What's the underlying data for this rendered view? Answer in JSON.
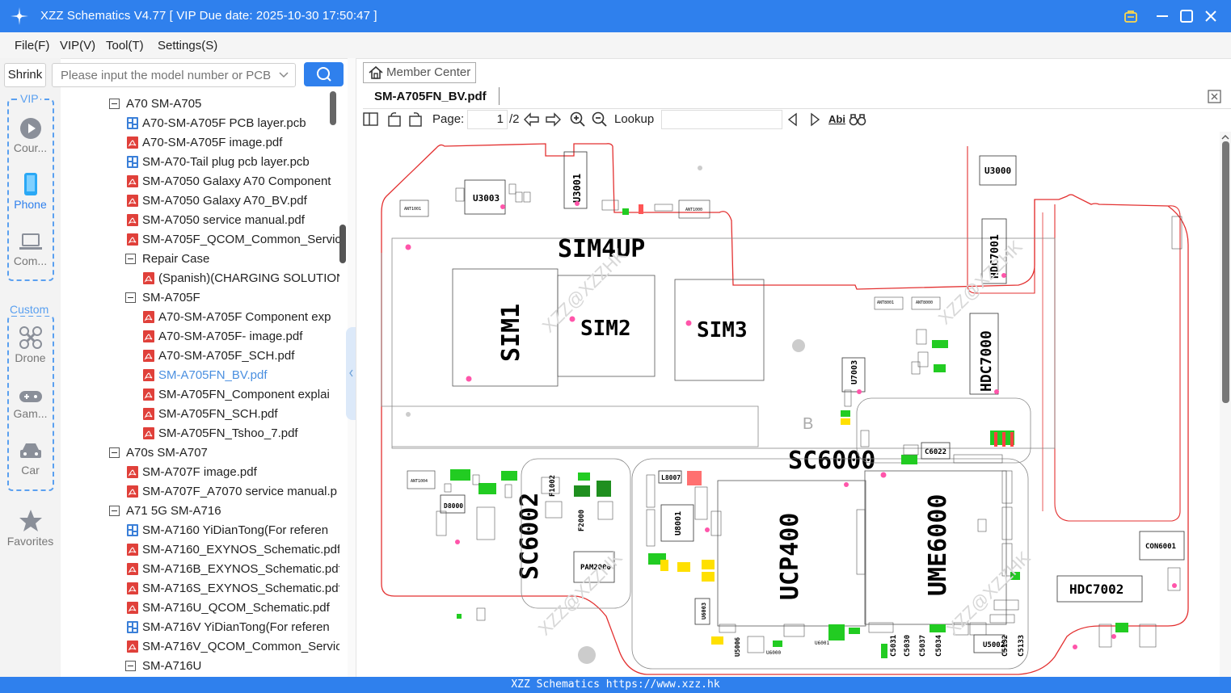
{
  "app": {
    "title": "XZZ Schematics V4.77 [ VIP Due date: 2025-10-30 17:50:47 ]",
    "status_bar": "XZZ Schematics https://www.xzz.hk"
  },
  "menu": [
    "File(F)",
    "VIP(V)",
    "Tool(T)",
    "Settings(S)"
  ],
  "search": {
    "shrink_label": "Shrink",
    "placeholder": "Please input the model number or PCB"
  },
  "rail": {
    "vip_label": "VIP",
    "custom_label": "Custom",
    "items": [
      "Cour...",
      "Phone",
      "Com...",
      "Drone",
      "Gam...",
      "Car",
      "Favorites"
    ]
  },
  "tree": [
    {
      "label": "A70 SM-A705",
      "kind": "folder"
    },
    {
      "label": "A70-SM-A705F PCB layer.pcb",
      "kind": "pcb"
    },
    {
      "label": "A70-SM-A705F image.pdf",
      "kind": "pdf"
    },
    {
      "label": "SM-A70-Tail plug pcb layer.pcb",
      "kind": "pcb"
    },
    {
      "label": "SM-A7050 Galaxy A70 Component",
      "kind": "pdf"
    },
    {
      "label": "SM-A7050 Galaxy A70_BV.pdf",
      "kind": "pdf"
    },
    {
      "label": "SM-A7050 service manual.pdf",
      "kind": "pdf"
    },
    {
      "label": "SM-A705F_QCOM_Common_Servic",
      "kind": "pdf"
    },
    {
      "label": "Repair Case",
      "kind": "folder"
    },
    {
      "label": "(Spanish)(CHARGING SOLUTION",
      "kind": "pdf"
    },
    {
      "label": "SM-A705F",
      "kind": "folder"
    },
    {
      "label": "A70-SM-A705F Component exp",
      "kind": "pdf"
    },
    {
      "label": "A70-SM-A705F- image.pdf",
      "kind": "pdf"
    },
    {
      "label": "A70-SM-A705F_SCH.pdf",
      "kind": "pdf"
    },
    {
      "label": "SM-A705FN_BV.pdf",
      "kind": "pdf",
      "selected": true
    },
    {
      "label": "SM-A705FN_Component explai",
      "kind": "pdf"
    },
    {
      "label": "SM-A705FN_SCH.pdf",
      "kind": "pdf"
    },
    {
      "label": "SM-A705FN_Tshoo_7.pdf",
      "kind": "pdf"
    },
    {
      "label": "A70s SM-A707",
      "kind": "folder"
    },
    {
      "label": "SM-A707F image.pdf",
      "kind": "pdf"
    },
    {
      "label": "SM-A707F_A7070 service manual.p",
      "kind": "pdf"
    },
    {
      "label": "A71 5G SM-A716",
      "kind": "folder"
    },
    {
      "label": "SM-A7160 YiDianTong(For referen",
      "kind": "pcb"
    },
    {
      "label": "SM-A7160_EXYNOS_Schematic.pdf",
      "kind": "pdf"
    },
    {
      "label": "SM-A716B_EXYNOS_Schematic.pdf",
      "kind": "pdf"
    },
    {
      "label": "SM-A716S_EXYNOS_Schematic.pdf",
      "kind": "pdf"
    },
    {
      "label": "SM-A716U_QCOM_Schematic.pdf",
      "kind": "pdf"
    },
    {
      "label": "SM-A716V YiDianTong(For referen",
      "kind": "pcb"
    },
    {
      "label": "SM-A716V_QCOM_Common_Servic",
      "kind": "pdf"
    },
    {
      "label": "SM-A716U",
      "kind": "folder"
    }
  ],
  "viewer": {
    "member_center": "Member Center",
    "tab_name": "SM-A705FN_BV.pdf",
    "page_label": "Page:",
    "page_value": "1",
    "page_total": "/2",
    "lookup_label": "Lookup",
    "abi_label": "Abi"
  },
  "board": {
    "big_labels": [
      "SIM4UP",
      "SIM1",
      "SIM2",
      "SIM3",
      "SC6000",
      "SC6002",
      "UCP400",
      "UME6000"
    ],
    "parts": [
      "U3003",
      "U3001",
      "U3000",
      "HDC7001",
      "HDC7000",
      "HDC7002",
      "U7003",
      "C6022",
      "CON6001",
      "D8000",
      "L8007",
      "U8001",
      "PAM2000",
      "F1002",
      "F2000",
      "U5002",
      "C5031",
      "C5030",
      "C5037",
      "C5034",
      "C5132",
      "C5133",
      "U6003",
      "U5006",
      "ANT1000",
      "ANT1001",
      "ANT1004",
      "ANT8000",
      "ANT8001",
      "U6000",
      "U6001",
      "B"
    ],
    "watermark": "XZZ@XZZHK",
    "colors": {
      "outline": "#e33030",
      "silk": "#000000",
      "pad_green": "#22cc22",
      "pad_yellow": "#ffe000",
      "marker": "#ff55aa"
    }
  }
}
